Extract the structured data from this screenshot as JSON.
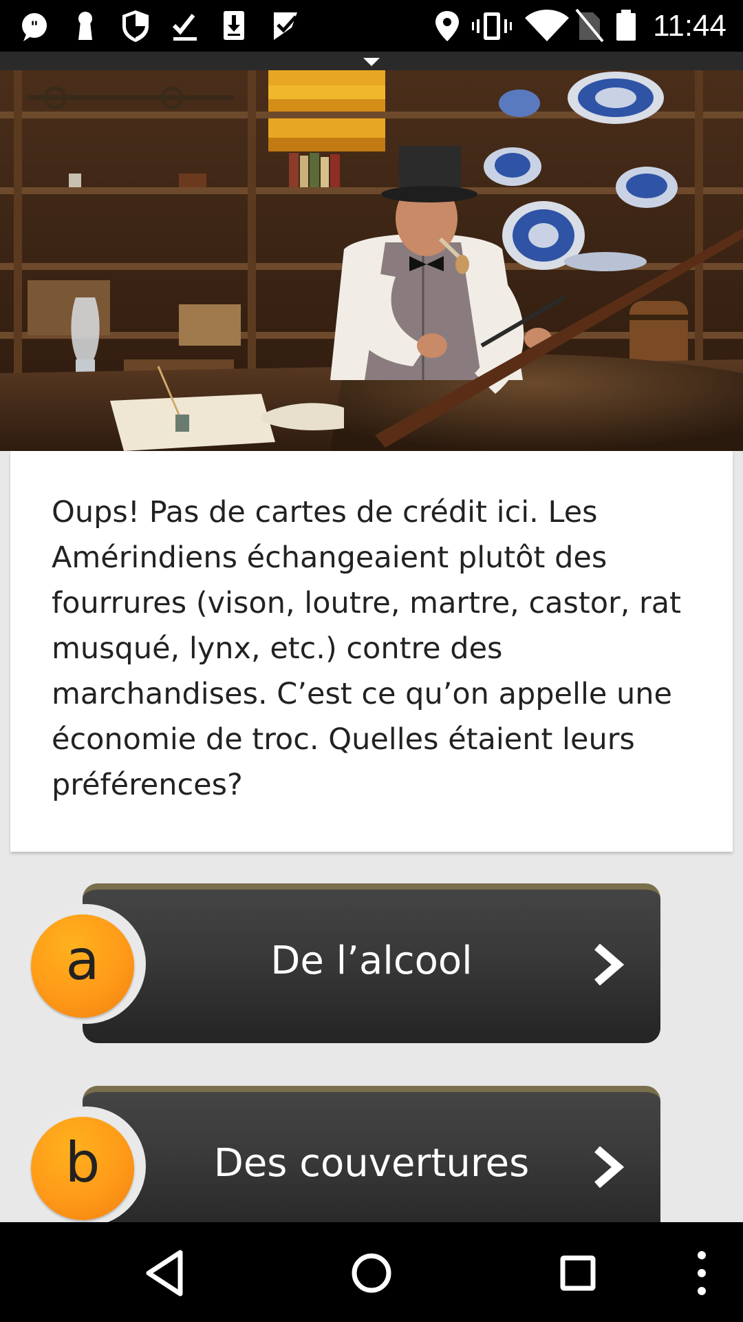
{
  "status_bar": {
    "time": "11:44",
    "left_icons": [
      "quote-icon",
      "keyhole-icon",
      "shield-icon",
      "download-done-icon",
      "download-icon",
      "check-icon"
    ],
    "right_icons": [
      "location-icon",
      "vibrate-icon",
      "wifi-icon",
      "no-sim-icon",
      "battery-icon"
    ]
  },
  "hero": {
    "icon": "collapse-arrow-icon"
  },
  "card": {
    "text": "Oups! Pas de cartes de crédit ici. Les Amérindiens échangeaient plutôt des fourrures (vison, loutre, martre, castor, rat musqué, lynx, etc.) contre des marchandises. C’est ce qu’on appelle une économie de troc. Quelles étaient leurs préférences?"
  },
  "answers": [
    {
      "letter": "a",
      "label": "De l’alcool"
    },
    {
      "letter": "b",
      "label": "Des couvertures"
    }
  ],
  "nav": {
    "icons": [
      "back-icon",
      "home-icon",
      "recents-icon",
      "overflow-menu-icon"
    ]
  },
  "colors": {
    "badge": "#ff9a18",
    "answer_bar": "#333333",
    "answer_accent": "#7a6f4c",
    "card": "#ffffff",
    "background": "#e8e8e8"
  }
}
